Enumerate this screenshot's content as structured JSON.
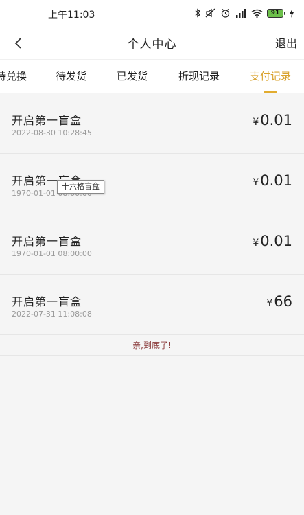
{
  "status_bar": {
    "time": "上午11:03",
    "battery": "91"
  },
  "nav": {
    "title": "个人中心",
    "logout": "退出"
  },
  "tabs": [
    {
      "label": "待兑换",
      "active": false
    },
    {
      "label": "待发货",
      "active": false
    },
    {
      "label": "已发货",
      "active": false
    },
    {
      "label": "折现记录",
      "active": false
    },
    {
      "label": "支付记录",
      "active": true
    }
  ],
  "records": [
    {
      "title": "开启第一盲盒",
      "time": "2022-08-30 10:28:45",
      "currency": "¥",
      "amount": "0.01"
    },
    {
      "title": "开启第一盲盒",
      "time": "1970-01-01 08:00:00",
      "currency": "¥",
      "amount": "0.01"
    },
    {
      "title": "开启第一盲盒",
      "time": "1970-01-01 08:00:00",
      "currency": "¥",
      "amount": "0.01"
    },
    {
      "title": "开启第一盲盒",
      "time": "2022-07-31 11:08:08",
      "currency": "¥",
      "amount": "66"
    }
  ],
  "tooltip": "十六格盲盒",
  "end_text": "亲,到底了!",
  "colors": {
    "accent": "#d9a22e",
    "background": "#f5f5f5",
    "end_text": "#8a3a3a"
  }
}
